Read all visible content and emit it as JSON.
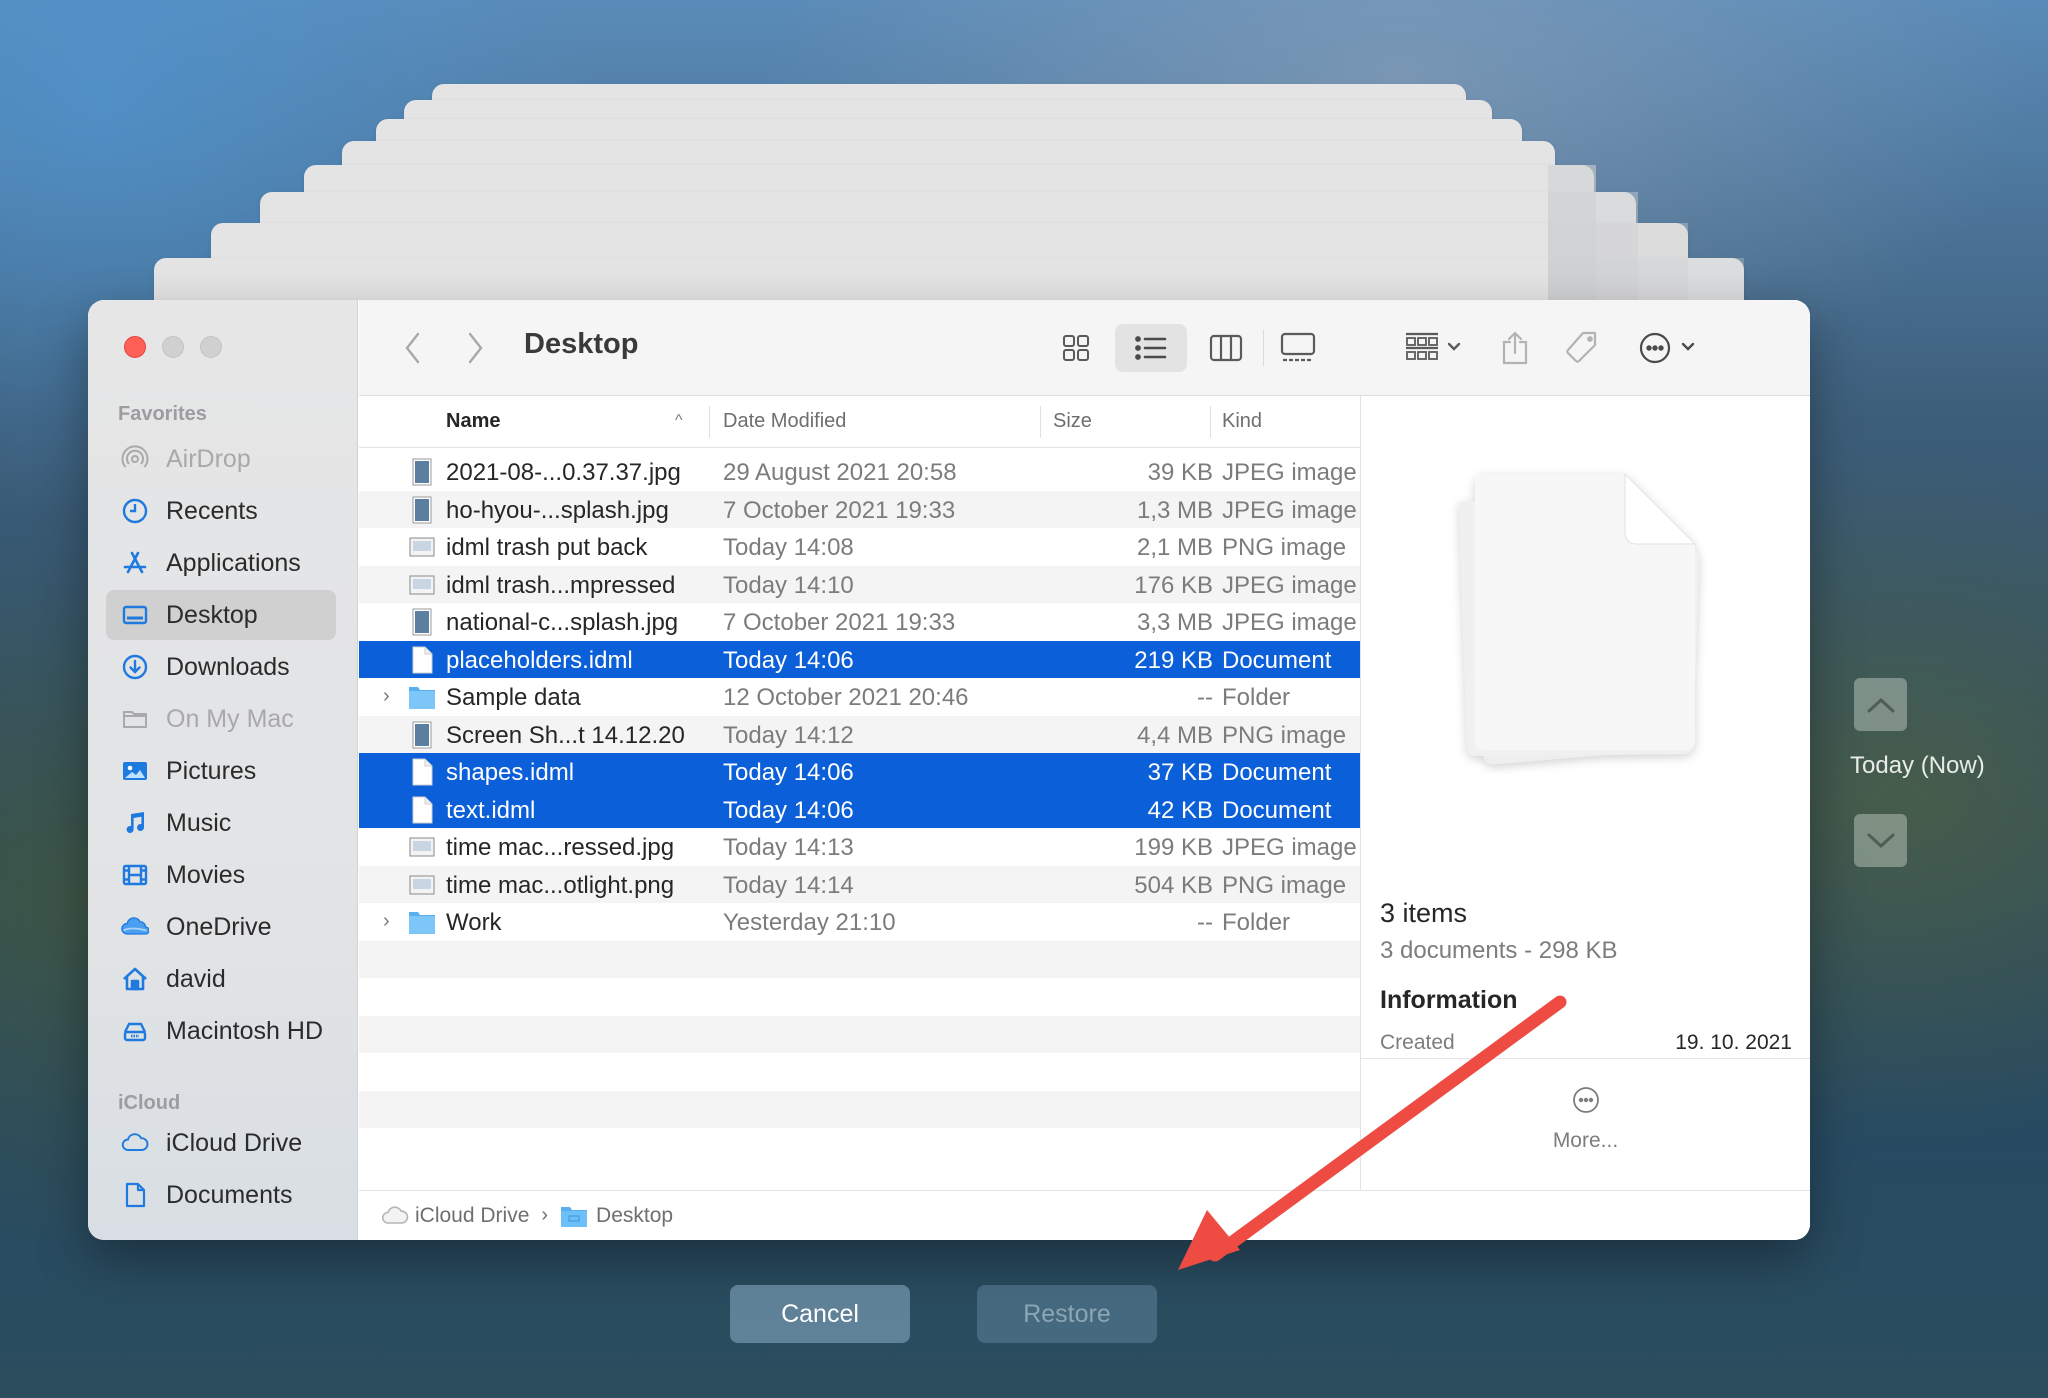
{
  "window": {
    "title": "Desktop",
    "traffic_lights": [
      "close",
      "minimize",
      "zoom"
    ]
  },
  "sidebar": {
    "sections": [
      {
        "label": "Favorites",
        "items": [
          {
            "label": "AirDrop",
            "icon": "airdrop-icon",
            "dim": true
          },
          {
            "label": "Recents",
            "icon": "clock-icon"
          },
          {
            "label": "Applications",
            "icon": "applications-icon"
          },
          {
            "label": "Desktop",
            "icon": "desktop-icon",
            "active": true
          },
          {
            "label": "Downloads",
            "icon": "download-icon"
          },
          {
            "label": "On My Mac",
            "icon": "folder-icon",
            "dim": true
          },
          {
            "label": "Pictures",
            "icon": "pictures-icon"
          },
          {
            "label": "Music",
            "icon": "music-icon"
          },
          {
            "label": "Movies",
            "icon": "movies-icon"
          },
          {
            "label": "OneDrive",
            "icon": "onedrive-cloud-icon"
          },
          {
            "label": "david",
            "icon": "home-icon"
          },
          {
            "label": "Macintosh HD",
            "icon": "hard-drive-icon"
          }
        ]
      },
      {
        "label": "iCloud",
        "items": [
          {
            "label": "iCloud Drive",
            "icon": "icloud-icon"
          },
          {
            "label": "Documents",
            "icon": "document-icon"
          }
        ]
      }
    ]
  },
  "toolbar": {
    "back": "back-icon",
    "forward": "forward-icon",
    "views": [
      "icon-view",
      "list-view",
      "column-view",
      "gallery-view"
    ],
    "active_view": "list-view",
    "group": "group-icon",
    "share": "share-icon",
    "tags": "tag-icon",
    "actions": "more-actions-icon",
    "search": "search-icon"
  },
  "list": {
    "columns": {
      "name": "Name",
      "date": "Date Modified",
      "size": "Size",
      "kind": "Kind"
    },
    "sort": {
      "column": "Name",
      "direction": "ascending"
    },
    "rows": [
      {
        "name": "2021-08-...0.37.37.jpg",
        "date": "29 August 2021 20:58",
        "size": "39 KB",
        "kind": "JPEG image",
        "icon": "image-file-icon",
        "selected": false,
        "folder": false
      },
      {
        "name": "ho-hyou-...splash.jpg",
        "date": "7 October 2021 19:33",
        "size": "1,3 MB",
        "kind": "JPEG image",
        "icon": "image-file-icon",
        "selected": false,
        "folder": false
      },
      {
        "name": "idml trash put back",
        "date": "Today 14:08",
        "size": "2,1 MB",
        "kind": "PNG image",
        "icon": "screenshot-file-icon",
        "selected": false,
        "folder": false
      },
      {
        "name": "idml trash...mpressed",
        "date": "Today 14:10",
        "size": "176 KB",
        "kind": "JPEG image",
        "icon": "screenshot-file-icon",
        "selected": false,
        "folder": false
      },
      {
        "name": "national-c...splash.jpg",
        "date": "7 October 2021 19:33",
        "size": "3,3 MB",
        "kind": "JPEG image",
        "icon": "image-file-icon",
        "selected": false,
        "folder": false
      },
      {
        "name": "placeholders.idml",
        "date": "Today 14:06",
        "size": "219 KB",
        "kind": "Document",
        "icon": "document-file-icon",
        "selected": true,
        "folder": false
      },
      {
        "name": "Sample data",
        "date": "12 October 2021 20:46",
        "size": "--",
        "kind": "Folder",
        "icon": "folder-icon",
        "selected": false,
        "folder": true
      },
      {
        "name": "Screen Sh...t 14.12.20",
        "date": "Today 14:12",
        "size": "4,4 MB",
        "kind": "PNG image",
        "icon": "image-file-icon",
        "selected": false,
        "folder": false
      },
      {
        "name": "shapes.idml",
        "date": "Today 14:06",
        "size": "37 KB",
        "kind": "Document",
        "icon": "document-file-icon",
        "selected": true,
        "folder": false
      },
      {
        "name": "text.idml",
        "date": "Today 14:06",
        "size": "42 KB",
        "kind": "Document",
        "icon": "document-file-icon",
        "selected": true,
        "folder": false
      },
      {
        "name": "time mac...ressed.jpg",
        "date": "Today 14:13",
        "size": "199 KB",
        "kind": "JPEG image",
        "icon": "screenshot-file-icon",
        "selected": false,
        "folder": false
      },
      {
        "name": "time mac...otlight.png",
        "date": "Today 14:14",
        "size": "504 KB",
        "kind": "PNG image",
        "icon": "screenshot-file-icon",
        "selected": false,
        "folder": false
      },
      {
        "name": "Work",
        "date": "Yesterday 21:10",
        "size": "--",
        "kind": "Folder",
        "icon": "folder-icon",
        "selected": false,
        "folder": true
      }
    ]
  },
  "preview": {
    "items_count": "3 items",
    "summary": "3 documents - 298 KB",
    "info_heading": "Information",
    "created_label": "Created",
    "created_value": "19. 10. 2021",
    "more_label": "More..."
  },
  "path_bar": {
    "segments": [
      {
        "label": "iCloud Drive",
        "icon": "icloud-icon"
      },
      {
        "label": "Desktop",
        "icon": "folder-icon"
      }
    ]
  },
  "dialog": {
    "cancel_label": "Cancel",
    "restore_label": "Restore",
    "restore_enabled": false
  },
  "timeline": {
    "current_label": "Today (Now)"
  },
  "annotation": {
    "arrow_color": "#ee4b43"
  },
  "colors": {
    "selection": "#0b5fd8",
    "accent_icon": "#1f7ae0",
    "close_button": "#fe5f57"
  }
}
